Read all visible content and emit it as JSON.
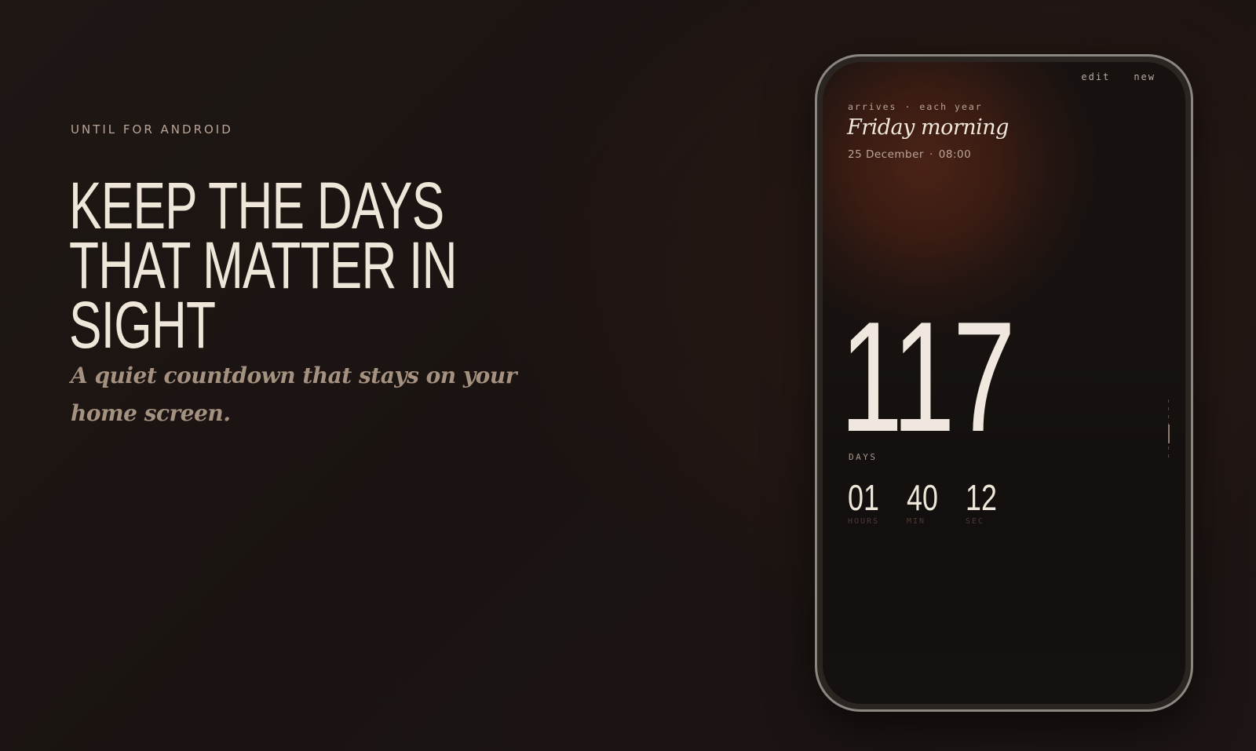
{
  "hero": {
    "eyebrow": "UNTIL FOR ANDROID",
    "headline_lines": [
      "KEEP THE DAYS",
      "THAT MATTER IN",
      "SIGHT"
    ],
    "subhead": "A quiet countdown that stays on your home screen."
  },
  "phone": {
    "actions": {
      "edit": "edit",
      "new": "new"
    },
    "meta": {
      "arrives": "arrives",
      "separator": "·",
      "repeat": "each year"
    },
    "event_title": "Friday morning",
    "event_date": "25 December",
    "event_time": "08:00",
    "days_value": "117",
    "days_label": "DAYS",
    "units": [
      {
        "value": "01",
        "label": "HOURS"
      },
      {
        "value": "40",
        "label": "MIN"
      },
      {
        "value": "12",
        "label": "SEC"
      }
    ]
  },
  "colors": {
    "background": "#1c1513",
    "headline": "#efe6da",
    "subhead": "#a5917f",
    "accent_glow": "#4a2216"
  }
}
